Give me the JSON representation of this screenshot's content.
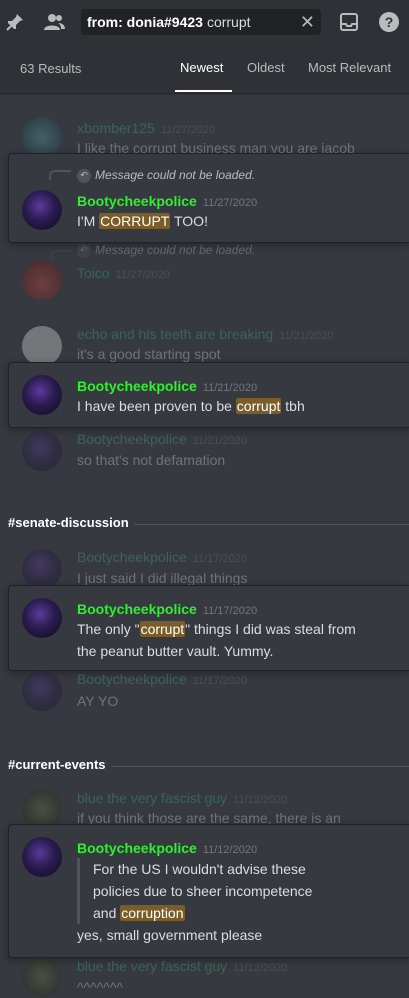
{
  "topbar": {
    "pin_icon": "pin-icon",
    "members_icon": "members-icon",
    "search": {
      "token": "from: donia#9423",
      "query": "corrupt"
    },
    "clear_icon": "close-icon",
    "inbox_icon": "inbox-icon",
    "help_icon": "help-icon"
  },
  "results": {
    "count": "63 Results",
    "sort": [
      "Newest",
      "Oldest",
      "Most Relevant"
    ]
  },
  "context": [
    {
      "user": "xbomber125",
      "time": "11/27/2020",
      "text": "I like the corrupt business man you are jacob"
    },
    {
      "user": "Toico",
      "time": "11/27/2020",
      "reply": "Message could not be loaded."
    },
    {
      "user": "echo and his teeth are breaking",
      "time": "11/21/2020",
      "text": "it's a good starting spot"
    },
    {
      "user": "Bootycheekpolice",
      "time": "11/21/2020",
      "text": "so that's not defamation"
    },
    {
      "user": "Bootycheekpolice",
      "time": "11/17/2020",
      "text": "I just said I did illegal things"
    },
    {
      "user": "Bootycheekpolice",
      "time": "11/17/2020",
      "text": "AY YO"
    },
    {
      "user": "blue the very fascist guy",
      "time": "11/12/2020",
      "text": "if you think those are the same, there is an"
    },
    {
      "user": "blue the very fascist guy",
      "time": "11/12/2020",
      "text": "^^^^^^^"
    }
  ],
  "channels": [
    "#senate-discussion",
    "#current-events"
  ],
  "cards": [
    {
      "reply": "Message could not be loaded.",
      "user": "Bootycheekpolice",
      "time": "11/27/2020",
      "parts": [
        "I'M ",
        "CORRUPT",
        " TOO!"
      ]
    },
    {
      "user": "Bootycheekpolice",
      "time": "11/21/2020",
      "parts": [
        "I have been proven to be ",
        "corrupt",
        " tbh"
      ]
    },
    {
      "user": "Bootycheekpolice",
      "time": "11/17/2020",
      "parts": [
        "The only \"",
        "corrupt",
        "\" things I did was steal from"
      ],
      "line2": "the peanut butter vault. Yummy."
    },
    {
      "user": "Bootycheekpolice",
      "time": "11/12/2020",
      "quote1": "For the US I wouldn't advise these",
      "quote2": "policies due to sheer incompetence",
      "quote3_parts": [
        "and ",
        "corruption"
      ],
      "text": "yes, small government please"
    }
  ]
}
